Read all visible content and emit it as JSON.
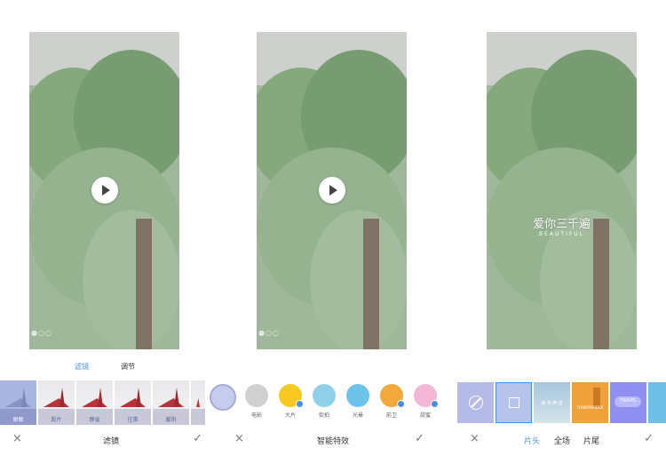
{
  "panel1": {
    "tabs": {
      "filter": "滤镜",
      "adjust": "调节"
    },
    "filters": [
      {
        "label": "原图",
        "selected": true
      },
      {
        "label": "胶片",
        "selected": false
      },
      {
        "label": "静谧",
        "selected": false
      },
      {
        "label": "往事",
        "selected": false
      },
      {
        "label": "暖阳",
        "selected": false
      }
    ],
    "bottom_title": "滤镜"
  },
  "panel2": {
    "effects": [
      {
        "label": "电影",
        "color": "#c8c8c8"
      },
      {
        "label": "大片",
        "color": "#f7c81f"
      },
      {
        "label": "街拍",
        "color": "#8fd0e8"
      },
      {
        "label": "光晕",
        "color": "#6cc3ea"
      },
      {
        "label": "前卫",
        "color": "#f2a93b"
      },
      {
        "label": "甜蜜",
        "color": "#f3b6d5"
      }
    ],
    "bottom_title": "智能特效"
  },
  "panel3": {
    "overlay_title": "爱你三千遍",
    "overlay_sub": "BEAUTIFUL",
    "tabs": {
      "head": "片头",
      "full": "全场",
      "tail": "片尾"
    },
    "tiles": [
      {
        "label": "",
        "color": "#b3bbe6"
      },
      {
        "label": "",
        "color": "#b6c3ea"
      },
      {
        "label": "城·市·声·音",
        "color": "#a6c6dc"
      },
      {
        "label": "TOWERBRIDGE",
        "color": "#f0a23a"
      },
      {
        "label": "TRAVEL",
        "color": "#8e8ff0"
      }
    ]
  },
  "icons": {
    "close": "×",
    "confirm": "✓"
  },
  "accent": "#4a90e2"
}
